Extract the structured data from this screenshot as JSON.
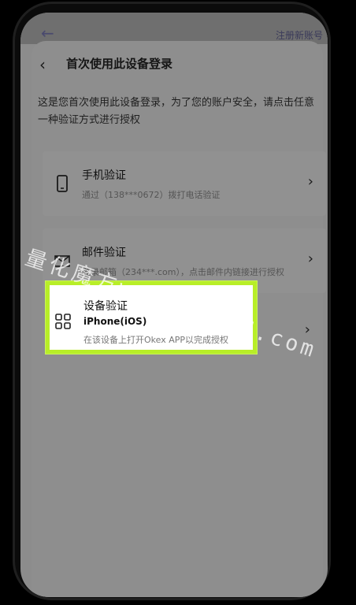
{
  "background_page": {
    "back_icon": "arrow-left-icon",
    "register_link": "注册新账号"
  },
  "header": {
    "back_icon": "chevron-left-icon",
    "title": "首次使用此设备登录"
  },
  "description": "这是您首次使用此设备登录，为了您的账户安全，请点击任意一种验证方式进行授权",
  "methods": [
    {
      "icon": "phone-icon",
      "title": "手机验证",
      "subtitle": "通过（138***0672）拨打电话验证"
    },
    {
      "icon": "mail-icon",
      "title": "邮件验证",
      "subtitle": "登录邮箱（234***.com），点击邮件内链接进行授权"
    },
    {
      "icon": "grid-icon",
      "title": "设备验证",
      "device": "iPhone(iOS)",
      "subtitle": "在该设备上打开Okex APP以完成授权"
    }
  ],
  "watermark": "量化魔方www.115KU.com",
  "colors": {
    "highlight_border": "#b8ee28",
    "overlay": "#8e8e8e"
  }
}
